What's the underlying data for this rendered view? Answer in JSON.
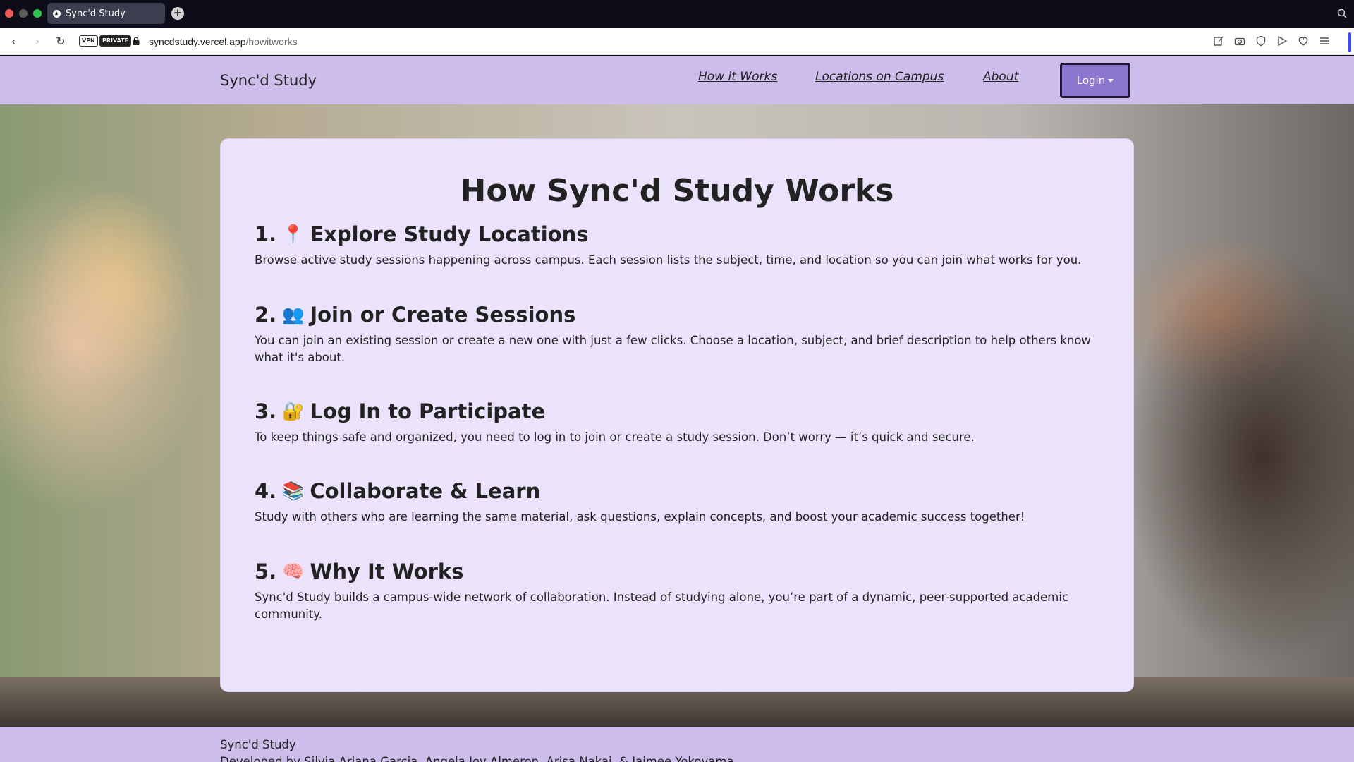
{
  "browser": {
    "tab_title": "Sync'd Study",
    "new_tab": "+",
    "badges": {
      "vpn": "VPN",
      "private": "PRIVATE"
    },
    "url_domain": "syncdstudy.vercel.app",
    "url_path": "/howitworks",
    "icons": [
      "back-icon",
      "forward-icon",
      "reload-icon",
      "lock-icon",
      "edit-icon",
      "camera-icon",
      "shield-icon",
      "send-icon",
      "heart-icon",
      "menu-icon",
      "search-icon"
    ]
  },
  "navbar": {
    "brand": "Sync'd Study",
    "links": [
      "How it Works",
      "Locations on Campus",
      "About"
    ],
    "login_label": "Login"
  },
  "main": {
    "title": "How Sync'd Study Works",
    "steps": [
      {
        "number": "1.",
        "emoji": "📍",
        "heading": "Explore Study Locations",
        "body": "Browse active study sessions happening across campus. Each session lists the subject, time, and location so you can join what works for you."
      },
      {
        "number": "2.",
        "emoji": "👥",
        "heading": "Join or Create Sessions",
        "body": "You can join an existing session or create a new one with just a few clicks. Choose a location, subject, and brief description to help others know what it's about."
      },
      {
        "number": "3.",
        "emoji": "🔐",
        "heading": "Log In to Participate",
        "body": "To keep things safe and organized, you need to log in to join or create a study session. Don’t worry — it’s quick and secure."
      },
      {
        "number": "4.",
        "emoji": "📚",
        "heading": "Collaborate & Learn",
        "body": "Study with others who are learning the same material, ask questions, explain concepts, and boost your academic success together!"
      },
      {
        "number": "5.",
        "emoji": "🧠",
        "heading": "Why It Works",
        "body": "Sync'd Study builds a campus-wide network of collaboration. Instead of studying alone, you’re part of a dynamic, peer-supported academic community."
      }
    ]
  },
  "footer": {
    "brand": "Sync'd Study",
    "credits": "Developed by Silvia Ariana Garcia, Angela Joy Almeron, Arisa Nakai, & Jaimee Yokoyama"
  },
  "colors": {
    "nav_bg": "#cdbdea",
    "card_bg": "#ebe2fb",
    "login_bg": "#8a77d0",
    "login_border": "#1d1436"
  }
}
